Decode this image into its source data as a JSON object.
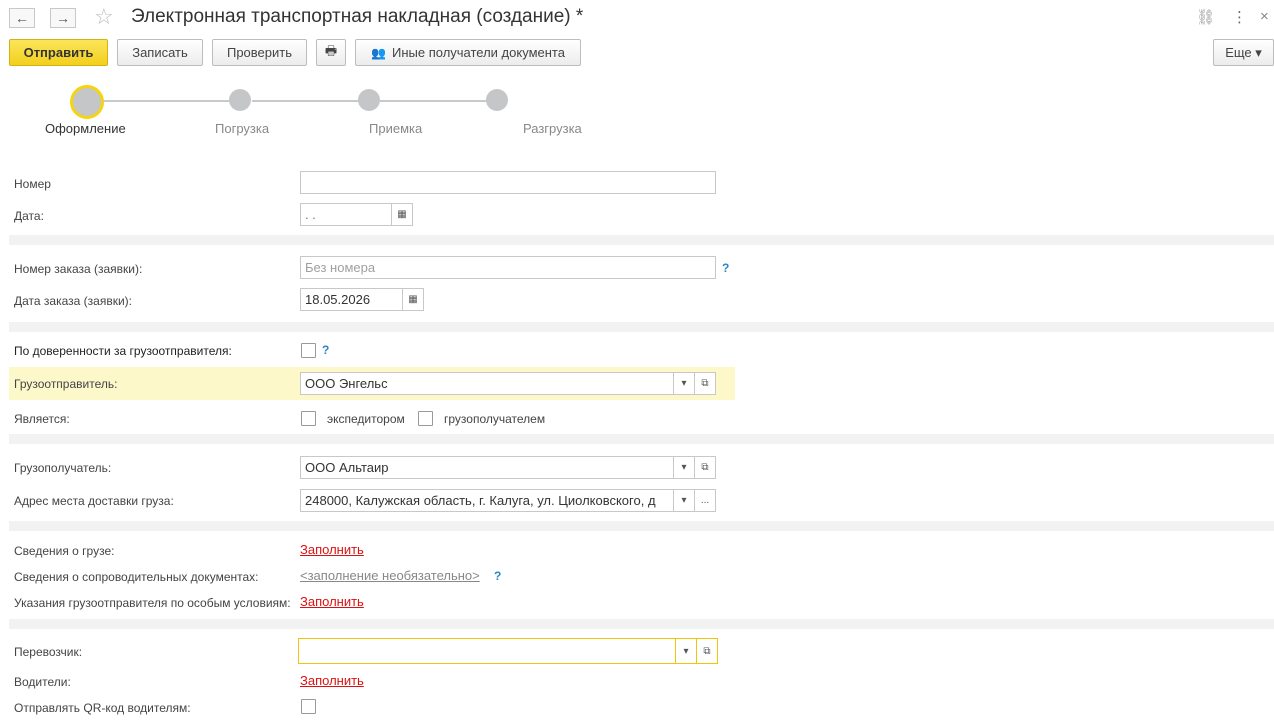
{
  "header": {
    "title": "Электронная транспортная накладная (создание) *",
    "back_icon": "←",
    "forward_icon": "→",
    "star_icon": "☆",
    "link_icon": "⛓",
    "more_icon": "⋮",
    "close_icon": "×"
  },
  "toolbar": {
    "send_label": "Отправить",
    "save_label": "Записать",
    "check_label": "Проверить",
    "print_icon": "🖶",
    "recipients_icon": "👥",
    "recipients_label": "Иные получатели документа",
    "more_label": "Еще ▾"
  },
  "steps": [
    {
      "label": "Оформление"
    },
    {
      "label": "Погрузка"
    },
    {
      "label": "Приемка"
    },
    {
      "label": "Разгрузка"
    }
  ],
  "form": {
    "number_label": "Номер",
    "number_value": "",
    "date_label": "Дата:",
    "date_value": " .  .",
    "order_number_label": "Номер заказа (заявки):",
    "order_number_placeholder": "Без номера",
    "order_date_label": "Дата заказа (заявки):",
    "order_date_value": "18.05.2026",
    "proxy_label": "По доверенности за грузоотправителя:",
    "shipper_label": "Грузоотправитель:",
    "shipper_value": "ООО Энгельс",
    "is_label": "Является:",
    "forwarder_label": "экспедитором",
    "consignee_cb_label": "грузополучателем",
    "consignee_label": "Грузополучатель:",
    "consignee_value": "ООО Альтаир",
    "address_label": "Адрес места доставки груза:",
    "address_value": "248000, Калужская область, г. Калуга, ул. Циолковского, д",
    "cargo_label": "Сведения о грузе:",
    "cargo_link": "Заполнить",
    "docs_label": "Сведения о сопроводительных документах:",
    "docs_link": "<заполнение необязательно>",
    "conditions_label": "Указания грузоотправителя по особым условиям:",
    "conditions_link": "Заполнить",
    "carrier_label": "Перевозчик:",
    "carrier_value": "",
    "drivers_label": "Водители:",
    "drivers_link": "Заполнить",
    "qr_label": "Отправлять QR-код водителям:",
    "help_mark": "?",
    "dropdown_arrow": "▾",
    "open_icon": "⧉",
    "calendar_icon": "▦",
    "ellipsis": "..."
  }
}
